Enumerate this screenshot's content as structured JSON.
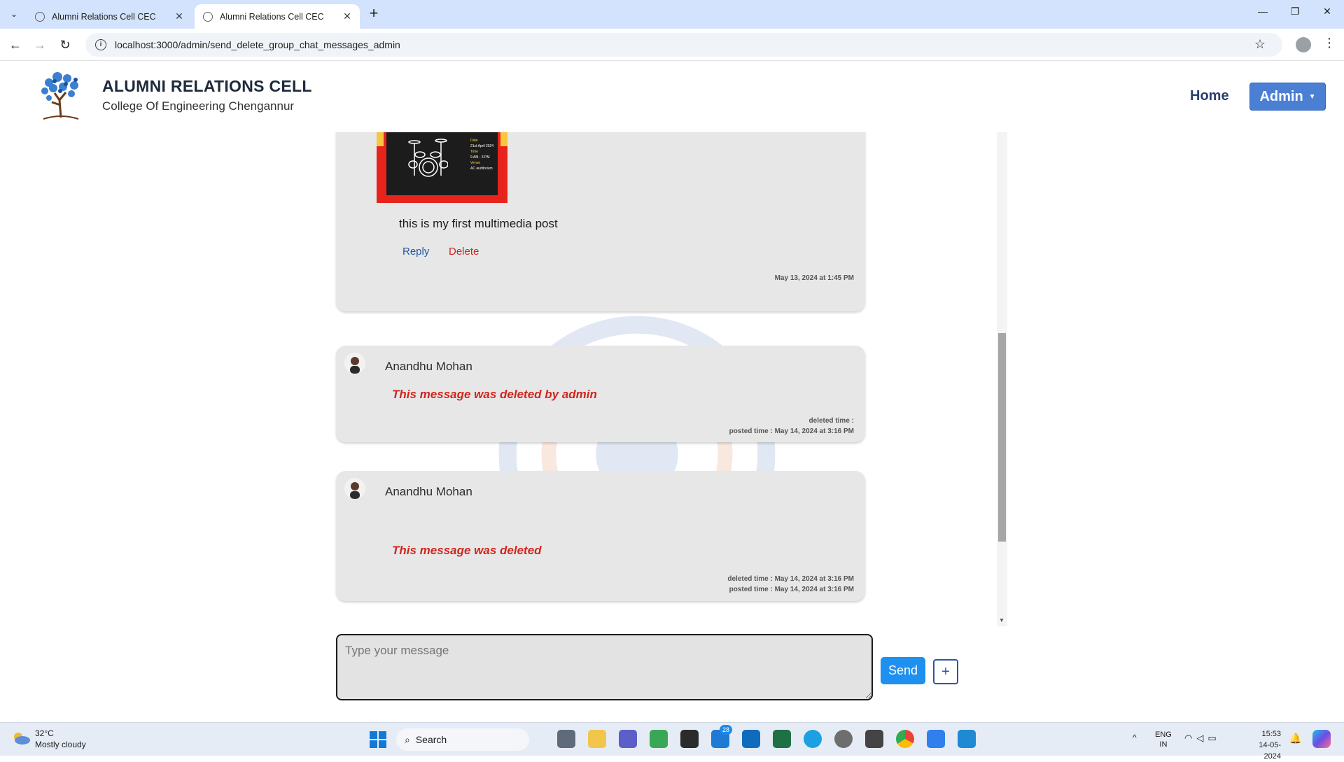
{
  "browser": {
    "tabs": [
      {
        "title": "Alumni Relations Cell CEC",
        "active": false
      },
      {
        "title": "Alumni Relations Cell CEC",
        "active": true
      }
    ],
    "url": "localhost:3000/admin/send_delete_group_chat_messages_admin",
    "icons": {
      "tab_search": "chevron-down-icon",
      "new_tab": "plus-icon",
      "back": "arrow-left-icon",
      "forward": "arrow-right-icon",
      "reload": "reload-icon",
      "site_info": "info-icon",
      "bookmark": "star-icon",
      "menu": "kebab-icon"
    }
  },
  "site": {
    "title": "ALUMNI RELATIONS CELL",
    "subtitle": "College Of Engineering Chengannur",
    "nav": {
      "home": "Home",
      "admin": "Admin"
    }
  },
  "messages": [
    {
      "type": "multimedia",
      "text": "this is my first multimedia post",
      "reply_label": "Reply",
      "delete_label": "Delete",
      "timestamp": "May 13, 2024 at 1:45 PM",
      "poster_lines": [
        "Date",
        "21st April 2024",
        "Time",
        "9 AM - 3 PM",
        "Venue",
        "AC auditorium"
      ]
    },
    {
      "type": "deleted",
      "sender": "Anandhu Mohan",
      "note": "This message was deleted by admin",
      "deleted_time": "deleted time :",
      "posted_time": "posted time : May 14, 2024 at 3:16 PM"
    },
    {
      "type": "deleted",
      "sender": "Anandhu Mohan",
      "note": "This message was deleted",
      "deleted_time": "deleted time : May 14, 2024 at 3:16 PM",
      "posted_time": "posted time : May 14, 2024 at 3:16 PM"
    }
  ],
  "composer": {
    "placeholder": "Type your message",
    "send_label": "Send",
    "attach_label": "+"
  },
  "taskbar": {
    "weather": {
      "temp": "32°C",
      "desc": "Mostly cloudy"
    },
    "search_label": "Search",
    "mail_badge": "28",
    "lang": {
      "line1": "ENG",
      "line2": "IN"
    },
    "clock": {
      "time": "15:53",
      "date": "14-05-2024"
    }
  },
  "colors": {
    "admin_button": "#4a7fd4",
    "send_button": "#1e90f0",
    "delete_red": "#d0251d",
    "reply_blue": "#2455a4",
    "card_bg": "#e7e7e7"
  }
}
